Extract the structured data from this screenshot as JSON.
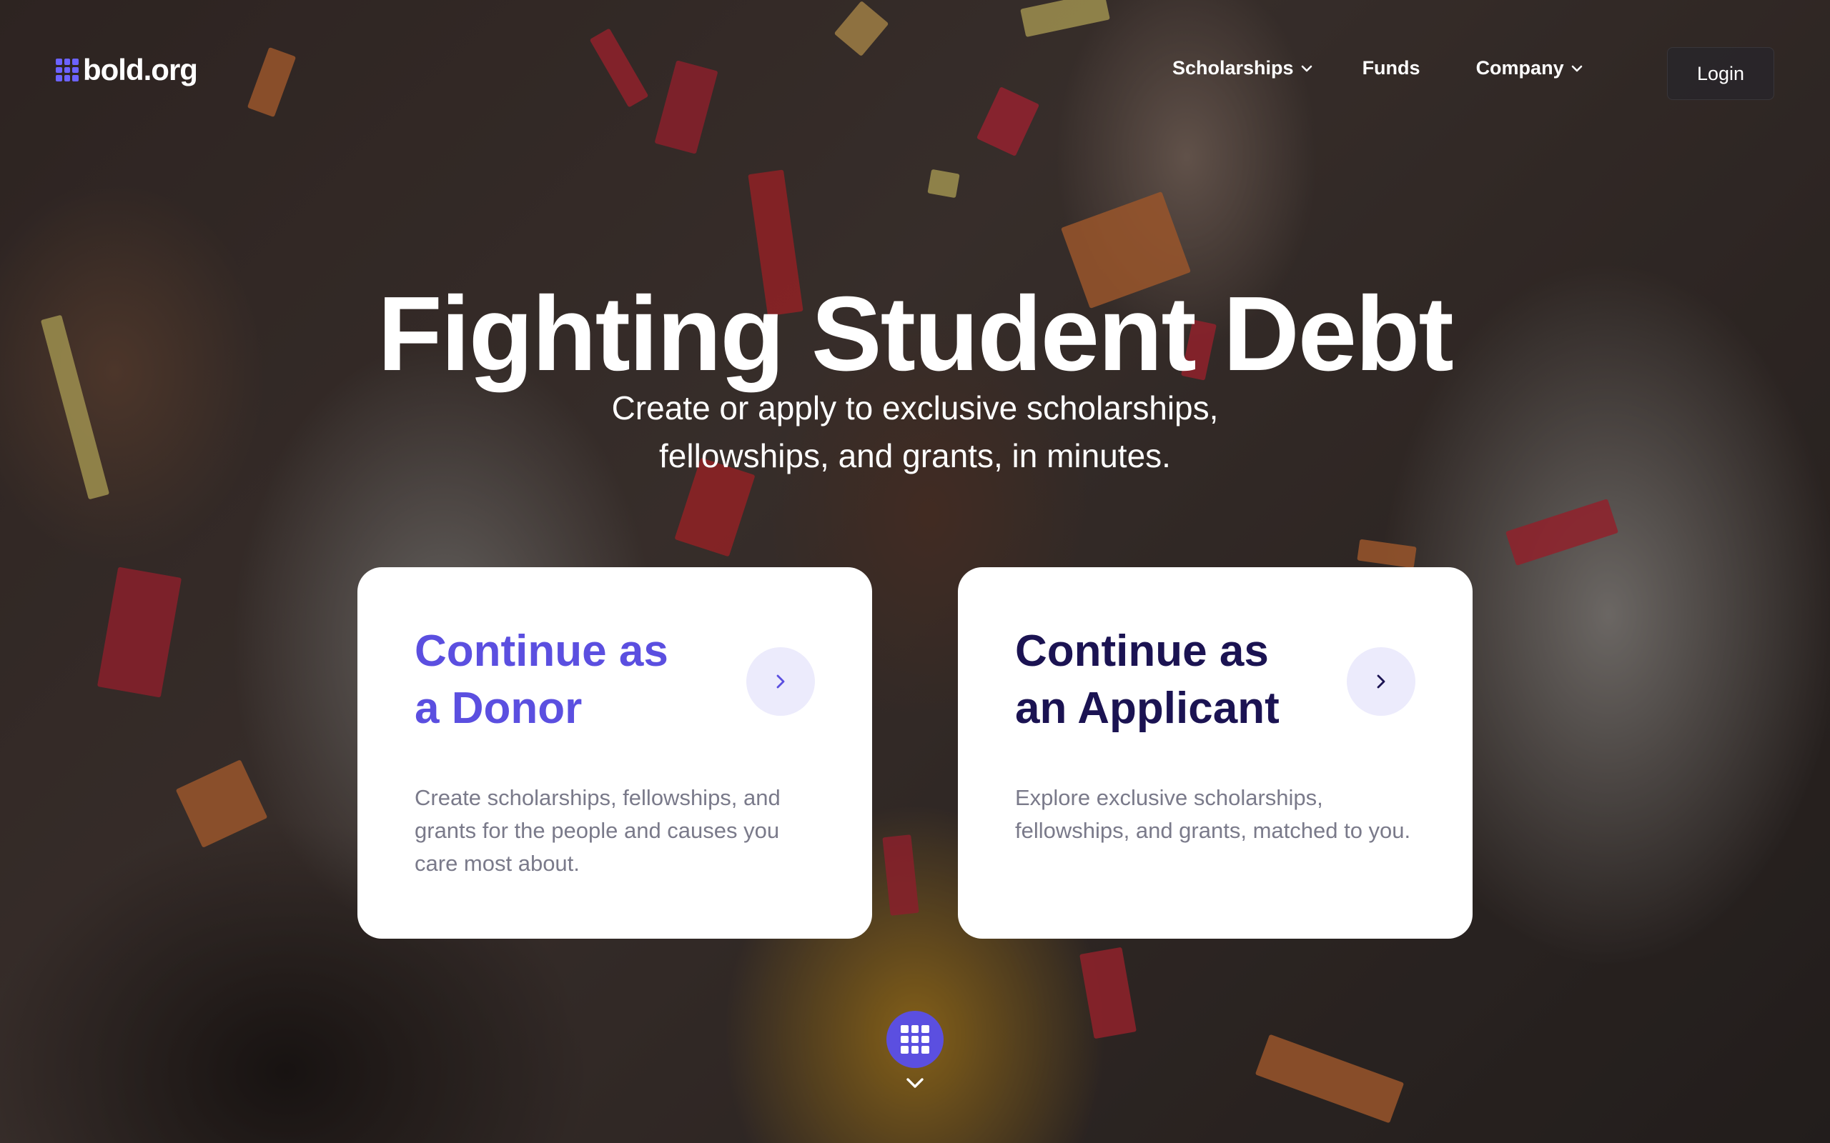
{
  "brand": {
    "name": "bold.org",
    "logo_icon": "grid-logo-icon",
    "accent_color": "#5b4fe0",
    "dark_color": "#1b1352"
  },
  "nav": {
    "items": [
      {
        "label": "Scholarships",
        "has_dropdown": true
      },
      {
        "label": "Funds",
        "has_dropdown": false
      },
      {
        "label": "Company",
        "has_dropdown": true
      }
    ],
    "login_label": "Login"
  },
  "hero": {
    "headline": "Fighting Student Debt",
    "subhead_line1": "Create or apply to exclusive scholarships,",
    "subhead_line2": "fellowships, and grants, in minutes."
  },
  "cards": {
    "donor": {
      "title_line1": "Continue as",
      "title_line2": "a Donor",
      "description": "Create scholarships, fellowships, and grants for the people and causes you care most about.",
      "icon": "chevron-right-icon"
    },
    "applicant": {
      "title_line1": "Continue as",
      "title_line2": "an Applicant",
      "description": "Explore exclusive scholarships, fellowships, and grants, matched to you.",
      "icon": "chevron-right-icon"
    }
  },
  "scroll_hint": {
    "badge_icon": "grid-logo-icon",
    "chevron_icon": "chevron-down-icon"
  }
}
